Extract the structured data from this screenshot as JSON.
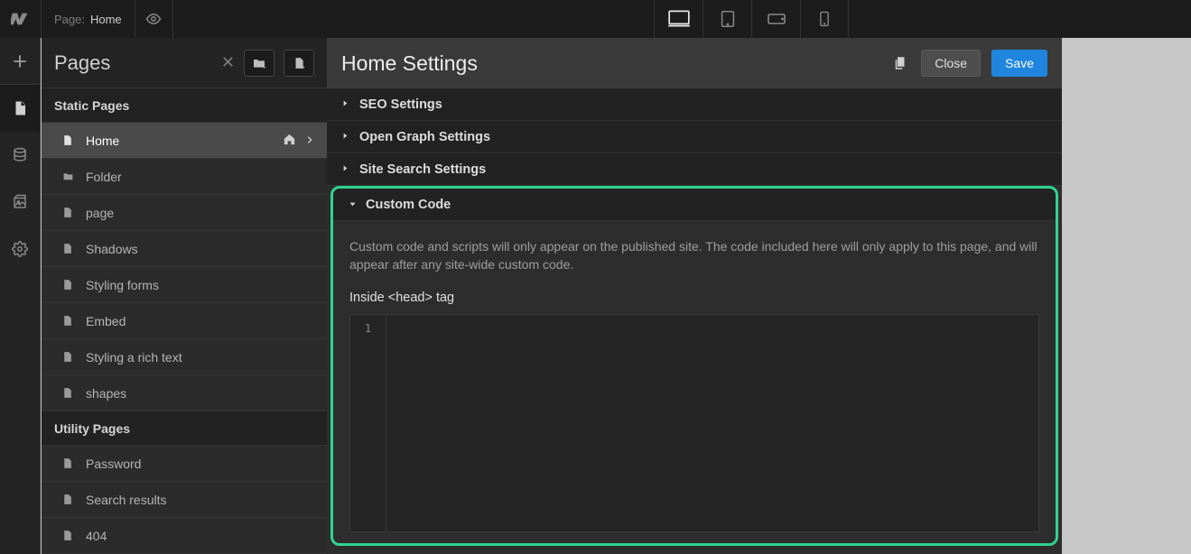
{
  "topbar": {
    "page_indicator_label": "Page:",
    "page_indicator_value": "Home"
  },
  "leftrail": {
    "items": [
      "add",
      "page",
      "database",
      "image",
      "settings"
    ]
  },
  "pages_panel": {
    "title": "Pages",
    "sections": {
      "static": {
        "label": "Static Pages",
        "items": [
          {
            "label": "Home",
            "type": "page",
            "selected": true,
            "is_home": true
          },
          {
            "label": "Folder",
            "type": "folder"
          },
          {
            "label": "page",
            "type": "page"
          },
          {
            "label": "Shadows",
            "type": "page"
          },
          {
            "label": "Styling forms",
            "type": "page"
          },
          {
            "label": "Embed",
            "type": "page"
          },
          {
            "label": "Styling a rich text",
            "type": "page"
          },
          {
            "label": "shapes",
            "type": "page"
          }
        ]
      },
      "utility": {
        "label": "Utility Pages",
        "items": [
          {
            "label": "Password",
            "type": "page"
          },
          {
            "label": "Search results",
            "type": "page"
          },
          {
            "label": "404",
            "type": "page"
          }
        ]
      }
    }
  },
  "settings_panel": {
    "title": "Home Settings",
    "close_label": "Close",
    "save_label": "Save",
    "accordions": [
      {
        "label": "SEO Settings",
        "expanded": false
      },
      {
        "label": "Open Graph Settings",
        "expanded": false
      },
      {
        "label": "Site Search Settings",
        "expanded": false
      }
    ],
    "custom_code": {
      "label": "Custom Code",
      "description": "Custom code and scripts will only appear on the published site. The code included here will only apply to this page, and will appear after any site-wide custom code.",
      "head_label": "Inside <head> tag",
      "editor_line": "1",
      "editor_value": ""
    }
  }
}
